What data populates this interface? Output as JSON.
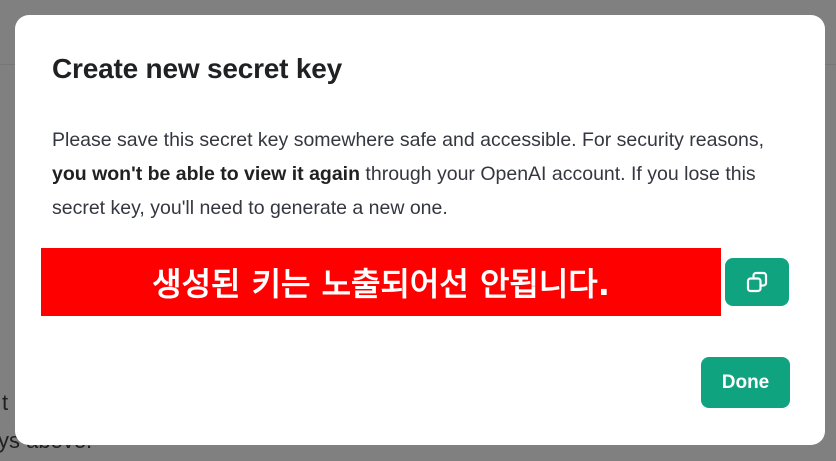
{
  "background": {
    "text_line_1": "t",
    "text_line_2": "ys above."
  },
  "modal": {
    "title": "Create new secret key",
    "description": {
      "part1": "Please save this secret key somewhere safe and accessible. For security reasons, ",
      "bold": "you won't be able to view it again",
      "part2": " through your OpenAI account. If you lose this secret key, you'll need to generate a new one."
    },
    "key_overlay_text": "생성된 키는 노출되어선 안됩니다.",
    "copy_button_icon": "copy-icon",
    "done_label": "Done"
  },
  "colors": {
    "accent": "#10a37f",
    "redaction": "#ff0000",
    "overlay": "#808080"
  }
}
